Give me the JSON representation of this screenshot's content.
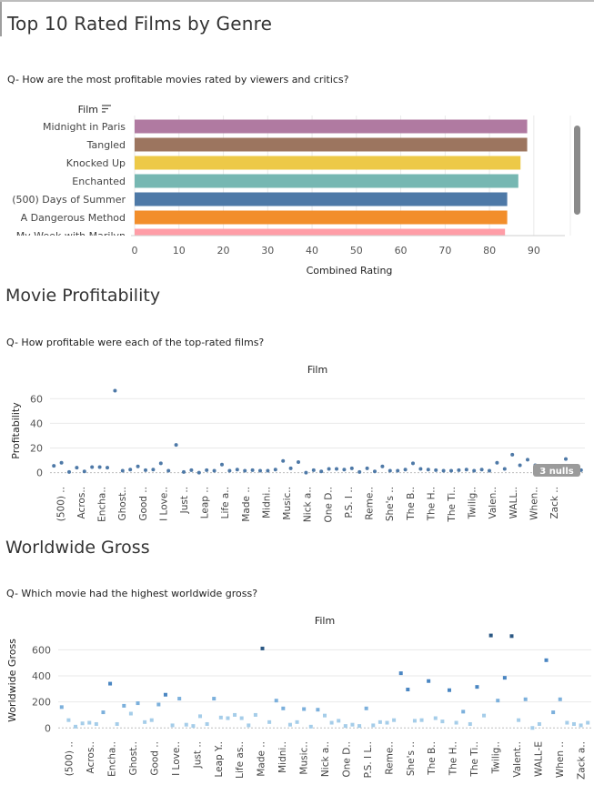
{
  "dashboard": {
    "title": "Top 10 Rated Films by Genre"
  },
  "colors": {
    "dot_default": "#4e79a7",
    "gross_dark": "#2a5783",
    "gross_light": "#a5cde9",
    "gridline": "#e9e9e9",
    "null_badge": "#9b9b9b"
  },
  "sections": {
    "ratings": {
      "question": "Q- How are the most profitable movies rated by viewers and critics?"
    },
    "profitability": {
      "title": "Movie Profitability",
      "question": "Q- How profitable were each of the top-rated films?"
    },
    "gross": {
      "title": "Worldwide Gross",
      "question": "Q- Which movie had the highest worldwide gross?"
    }
  },
  "chart_data": [
    {
      "type": "bar",
      "orientation": "horizontal",
      "row_header": "Film",
      "categories": [
        "Midnight in Paris",
        "Tangled",
        "Knocked Up",
        "Enchanted",
        "(500) Days of Summer",
        "A Dangerous Method",
        "My Week with Marilyn"
      ],
      "values": [
        88.5,
        88.5,
        87,
        86.5,
        84,
        84,
        83.5
      ],
      "colors": [
        "#b07aa1",
        "#9c755f",
        "#edc948",
        "#76b7b2",
        "#4e79a7",
        "#f28e2b",
        "#ff9da7"
      ],
      "xlabel": "Combined Rating",
      "xticks": [
        0,
        10,
        20,
        30,
        40,
        50,
        60,
        70,
        80,
        90
      ],
      "xlim": [
        0,
        97
      ],
      "scrollbar": "right"
    },
    {
      "type": "scatter",
      "header": "Film",
      "ylabel": "Profitability",
      "yticks": [
        0,
        20,
        40,
        60
      ],
      "ylim": [
        -4,
        72
      ],
      "null_badge": "3 nulls",
      "xlabels": [
        "(500) ..",
        "Acros..",
        "Encha..",
        "Ghost..",
        "Good ..",
        "I Love..",
        "Just ..",
        "Leap ..",
        "Life a..",
        "Made ..",
        "Midni..",
        "Music..",
        "Nick a..",
        "One D..",
        "P.S. I ..",
        "Reme..",
        "She's ..",
        "The B..",
        "The H..",
        "The Ti..",
        "Twilig..",
        "Valen..",
        "WALL..",
        "When..",
        "Zack ..",
        ""
      ],
      "values": [
        5.5,
        8,
        0.5,
        4,
        1,
        4.5,
        4.5,
        4,
        66.5,
        1.5,
        2.5,
        5,
        2,
        2.5,
        7.5,
        1.5,
        22.5,
        0.5,
        2,
        0,
        2,
        1.5,
        6.5,
        1.5,
        2.5,
        1.5,
        2,
        1.5,
        1.5,
        2.5,
        9.5,
        3.5,
        8.5,
        0,
        2,
        1,
        3,
        3,
        2.5,
        3.5,
        0.5,
        3.5,
        1,
        5,
        1.5,
        1.5,
        2.5,
        7.5,
        3,
        2.5,
        2,
        1.5,
        1.5,
        2,
        2.5,
        1.5,
        2.5,
        1.5,
        8,
        3,
        14.5,
        6,
        10.5,
        6,
        3.5,
        4,
        0,
        11,
        2,
        2
      ]
    },
    {
      "type": "scatter",
      "header": "Film",
      "ylabel": "Worldwide Gross",
      "yticks": [
        0,
        200,
        400,
        600
      ],
      "ylim": [
        -40,
        770
      ],
      "xlabels": [
        "(500) ..",
        "Acros..",
        "Encha..",
        "Ghost..",
        "Good ..",
        "I Love..",
        "Just ..",
        "Leap Y..",
        "Life as..",
        "Made ..",
        "Midni..",
        "Music..",
        "Nick a..",
        "One D..",
        "P.S. I L..",
        "Reme..",
        "She's ..",
        "The B..",
        "The H..",
        "The Ti..",
        "Twilig..",
        "Valent..",
        "WALL-E",
        "When ..",
        "Zack a.."
      ],
      "values": [
        160,
        60,
        10,
        35,
        40,
        30,
        120,
        340,
        30,
        170,
        110,
        190,
        45,
        60,
        180,
        255,
        20,
        225,
        25,
        15,
        90,
        30,
        225,
        80,
        75,
        100,
        75,
        20,
        100,
        610,
        45,
        210,
        150,
        25,
        45,
        145,
        10,
        140,
        95,
        40,
        55,
        15,
        25,
        15,
        150,
        20,
        45,
        40,
        60,
        420,
        295,
        55,
        60,
        360,
        75,
        50,
        290,
        40,
        125,
        30,
        315,
        95,
        710,
        210,
        385,
        705,
        60,
        220,
        0,
        30,
        520,
        120,
        220,
        40,
        30,
        20,
        40
      ]
    }
  ]
}
